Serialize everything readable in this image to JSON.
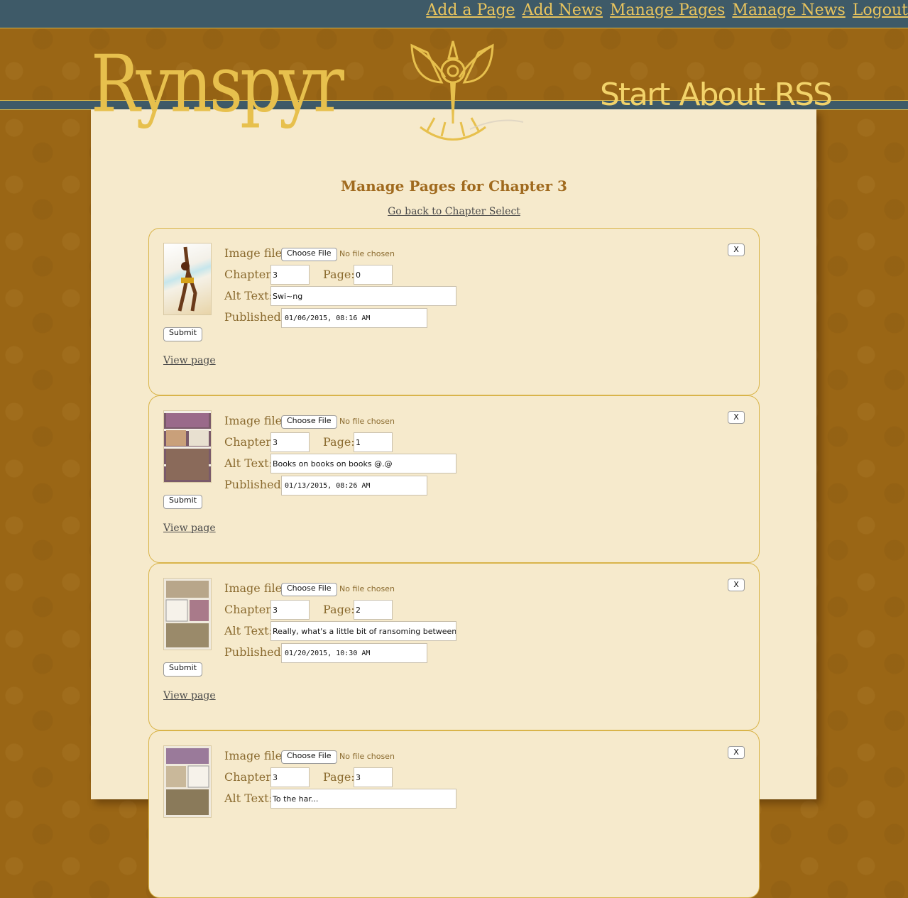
{
  "topnav": {
    "items": [
      "Add a Page",
      "Add News",
      "Manage Pages",
      "Manage News",
      "Logout"
    ]
  },
  "header": {
    "logo_text": "Rynspyr",
    "site_nav": [
      "Start",
      "About",
      "RSS"
    ]
  },
  "main": {
    "title": "Manage Pages for Chapter 3",
    "back_link": "Go back to Chapter Select",
    "labels": {
      "image_file": "Image file:",
      "chapter": "Chapter:",
      "page": "Page:",
      "alt_text": "Alt Text:",
      "published": "Published:",
      "choose_file": "Choose File",
      "no_file": "No file chosen",
      "submit": "Submit",
      "view_page": "View page",
      "delete": "X"
    },
    "pages": [
      {
        "chapter": "3",
        "page": "0",
        "alt": "Swi~ng",
        "published": "01/06/2015, 08:16 AM"
      },
      {
        "chapter": "3",
        "page": "1",
        "alt": "Books on books on books @.@",
        "published": "01/13/2015, 08:26 AM"
      },
      {
        "chapter": "3",
        "page": "2",
        "alt": "Really, what's a little bit of ransoming between fr",
        "published": "01/20/2015, 10:30 AM"
      },
      {
        "chapter": "3",
        "page": "3",
        "alt": "To the har...",
        "published": ""
      }
    ]
  },
  "colors": {
    "background": "#9a6615",
    "topbar": "#3e5a68",
    "panel": "#f6eacc",
    "gold": "#e7c04d",
    "heading": "#a06a1e"
  }
}
